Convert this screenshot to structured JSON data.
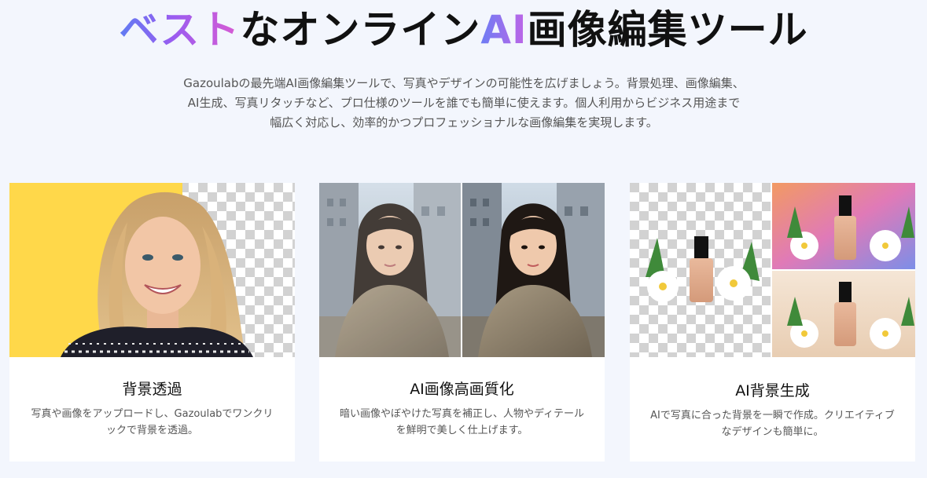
{
  "hero": {
    "title_grad_a": "ベスト",
    "title_mid": "なオンライン",
    "title_grad_b": "AI",
    "title_end": "画像編集ツール",
    "description_lines": [
      "Gazoulabの最先端AI画像編集ツールで、写真やデザインの可能性を広げましょう。背景処理、画像編集、",
      "AI生成、写真リタッチなど、プロ仕様のツールを誰でも簡単に使えます。個人利用からビジネス用途まで",
      "幅広く対応し、効率的かつプロフェッショナルな画像編集を実現します。"
    ]
  },
  "cards": [
    {
      "title": "背景透過",
      "description": "写真や画像をアップロードし、Gazoulabでワンクリックで背景を透過。",
      "image_alt": "portrait-with-transparent-background",
      "accent_color": "#ffd84a"
    },
    {
      "title": "AI画像高画質化",
      "description": "暗い画像やぼやけた写真を補正し、人物やディテールを鮮明で美しく仕上げます。",
      "image_alt": "before-after-enhancement-portrait"
    },
    {
      "title": "AI背景生成",
      "description": "AIで写真に合った背景を一瞬で作成。クリエイティブなデザインも簡単に。",
      "image_alt": "product-bottle-with-generated-backgrounds"
    }
  ]
}
